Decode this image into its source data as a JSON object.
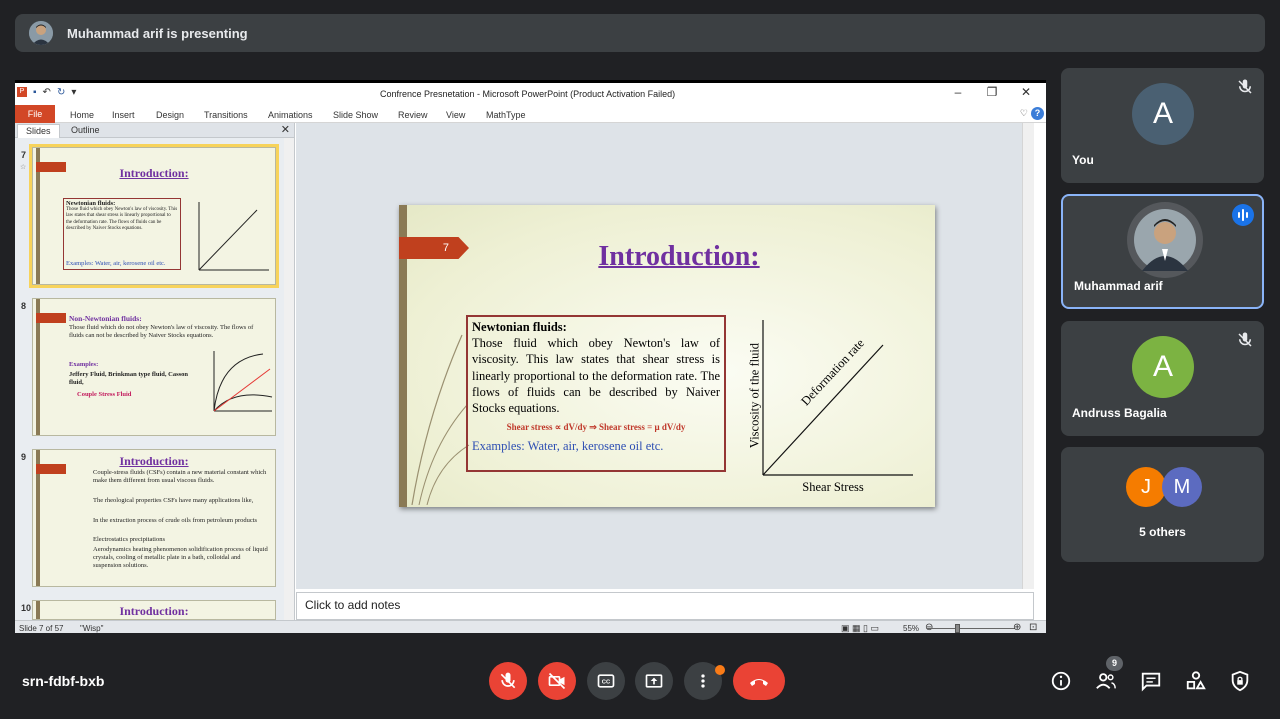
{
  "presenter": {
    "text": "Muhammad arif is presenting"
  },
  "ppt": {
    "window_title": "Confrence Presnetation - Microsoft PowerPoint (Product Activation Failed)",
    "ribbon_tabs": [
      "File",
      "Home",
      "Insert",
      "Design",
      "Transitions",
      "Animations",
      "Slide Show",
      "Review",
      "View",
      "MathType"
    ],
    "pane_tabs": [
      "Slides",
      "Outline"
    ],
    "thumbs": [
      {
        "num": "7",
        "title": "Introduction:"
      },
      {
        "num": "8",
        "title": "Non-Newtonian fluids:",
        "body": "Those fluid which do not obey Newton's law of viscosity. The flows of fluids can not be described by Naiver Stocks equations.",
        "examples_head": "Examples:",
        "examples": "Jeffery Fluid, Brinkman type fluid, Casson fluid,",
        "couple": "Couple Stress Fluid"
      },
      {
        "num": "9",
        "title": "Introduction:",
        "bullets": [
          "Couple-stress fluids (CSFs) contain a new material constant which make them different from usual viscous fluids.",
          "The rheological properties CSFs have many applications like,",
          "In the extraction process of crude oils from petroleum products",
          "Electrostatics precipitations",
          "Aerodynamics heating phenomenon solidification process of liquid crystals, cooling of metallic plate in a bath, colloidal and suspension solutions."
        ]
      },
      {
        "num": "10",
        "title": "Introduction:"
      }
    ],
    "slide": {
      "number": "7",
      "title": "Introduction:",
      "def_head": "Newtonian fluids:",
      "def_text": "Those fluid which obey Newton's law of viscosity.  This law states that shear stress is linearly proportional to the deformation rate. The flows of fluids can be described by Naiver Stocks equations.",
      "formula": "Shear stress ∝ dV/dy ⇒ Shear stress = μ dV/dy",
      "examples": "Examples: Water, air, kerosene oil etc.",
      "y_label": "Viscosity of the fluid",
      "x_label": "Shear Stress",
      "line_label": "Deformation rate"
    },
    "notes_placeholder": "Click to add notes",
    "status": {
      "slide": "Slide 7 of 57",
      "theme": "\"Wisp\"",
      "zoom": "55%"
    }
  },
  "participants": [
    {
      "name": "You",
      "initial": "A",
      "color": "#4a6072"
    },
    {
      "name": "Muhammad arif"
    },
    {
      "name": "Andruss Bagalia",
      "initial": "A",
      "color": "#7cb342"
    }
  ],
  "others": {
    "initials": [
      "J",
      "M"
    ],
    "colors": [
      "#f57c00",
      "#5c6bc0"
    ],
    "label": "5 others"
  },
  "meeting": {
    "code": "srn-fdbf-bxb",
    "people_count": "9"
  }
}
